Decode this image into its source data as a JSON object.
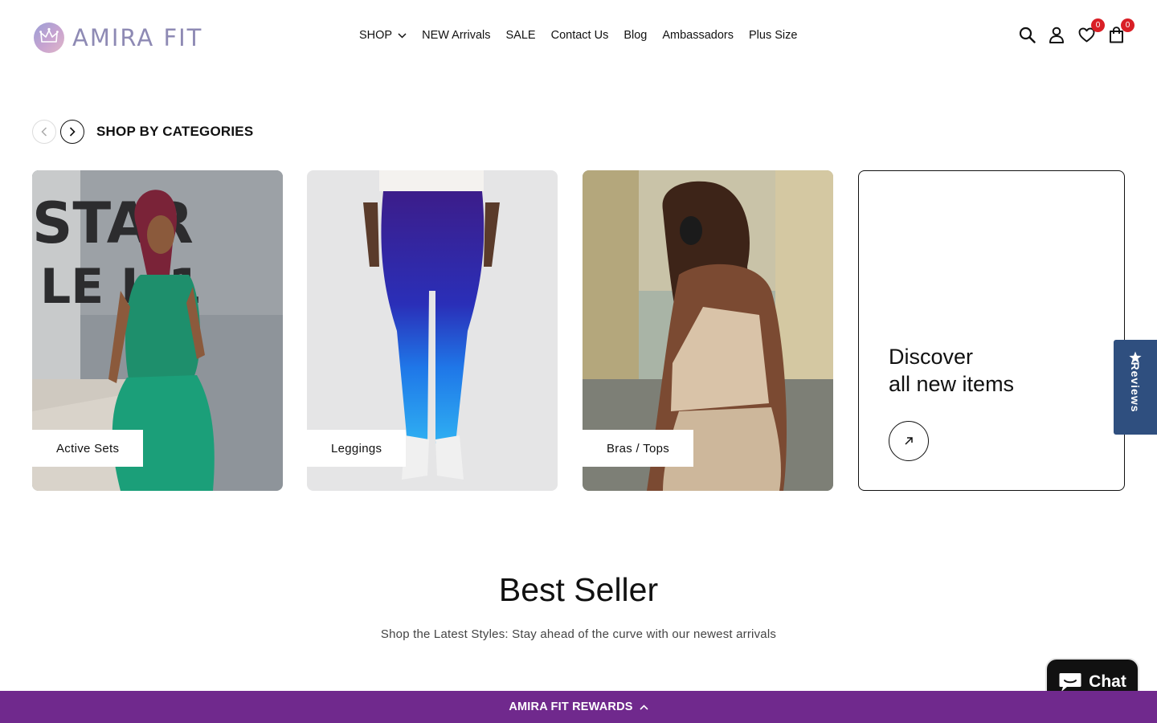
{
  "header": {
    "logo_text": "AMIRA FIT",
    "nav": [
      {
        "label": "SHOP",
        "has_dropdown": true
      },
      {
        "label": "NEW Arrivals"
      },
      {
        "label": "SALE"
      },
      {
        "label": "Contact Us"
      },
      {
        "label": "Blog"
      },
      {
        "label": "Ambassadors"
      },
      {
        "label": "Plus Size"
      }
    ],
    "wishlist_count": "0",
    "cart_count": "0",
    "icons": [
      "search-icon",
      "account-icon",
      "heart-icon",
      "bag-icon"
    ]
  },
  "categories": {
    "title": "SHOP BY CATEGORIES",
    "cards": [
      {
        "label": "Active Sets"
      },
      {
        "label": "Leggings"
      },
      {
        "label": "Bras / Tops"
      }
    ],
    "discover": {
      "line1": "Discover",
      "line2": "all new items"
    }
  },
  "reviews_tab": {
    "label": "Reviews"
  },
  "best_seller": {
    "title": "Best Seller",
    "subtitle": "Shop the Latest Styles: Stay ahead of the curve with our newest arrivals"
  },
  "chat": {
    "label": "Chat"
  },
  "rewards": {
    "label": "AMIRA FIT REWARDS"
  },
  "colors": {
    "rewards_bar": "#70298d",
    "reviews_tab": "#2f4f7f",
    "badge": "#d91f26",
    "logo": "#8e8ab4"
  }
}
